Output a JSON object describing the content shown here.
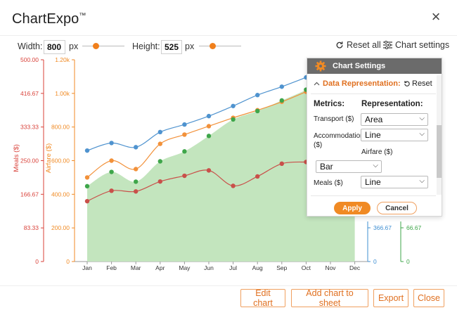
{
  "app": {
    "title": "ChartExpo",
    "trademark": "™",
    "close_label": "×"
  },
  "toolbar": {
    "width_label": "Width:",
    "width_value": "800",
    "width_unit": "px",
    "height_label": "Height:",
    "height_value": "525",
    "height_unit": "px",
    "width_slider_fraction": 0.3,
    "height_slider_fraction": 0.3,
    "reset_all_label": "Reset all",
    "chart_settings_label": "Chart settings"
  },
  "chart_data": {
    "type": "line",
    "categories": [
      "Jan",
      "Feb",
      "Mar",
      "Apr",
      "May",
      "Jun",
      "Jul",
      "Aug",
      "Sep",
      "Oct",
      "Nov",
      "Dec"
    ],
    "axes": [
      {
        "name": "Meals ($)",
        "color": "#d9423a",
        "ticks": [
          "500.00",
          "416.67",
          "333.33",
          "250.00",
          "166.67",
          "83.33",
          "0"
        ],
        "range": [
          0,
          500
        ]
      },
      {
        "name": "Airfare ($)",
        "color": "#f08a24",
        "ticks": [
          "1.20k",
          "1.00k",
          "800.00",
          "600.00",
          "400.00",
          "200.00",
          "0"
        ],
        "range": [
          0,
          1200
        ]
      },
      {
        "name": "Transport ($)",
        "color": "#3f8fd2",
        "ticks": [
          "366.67",
          "0"
        ]
      },
      {
        "name": "Accommodation ($)",
        "color": "#3ea64a",
        "ticks": [
          "66.67",
          "0"
        ]
      }
    ],
    "series": [
      {
        "name": "Transport ($)",
        "type": "line",
        "color": "#4f93cf",
        "values": [
          660,
          705,
          680,
          770,
          815,
          865,
          925,
          990,
          1040,
          1095,
          null,
          null
        ]
      },
      {
        "name": "Airfare ($)",
        "type": "line",
        "color": "#f2913a",
        "values": [
          500,
          600,
          550,
          700,
          755,
          805,
          855,
          900,
          950,
          1010,
          null,
          null
        ]
      },
      {
        "name": "Accommodation ($)",
        "type": "area",
        "color": "#3ea64a",
        "fill": "#c3e5be",
        "values": [
          448,
          533,
          475,
          596,
          655,
          747,
          845,
          895,
          958,
          1022,
          1110,
          1150
        ]
      },
      {
        "name": "Meals ($)",
        "type": "line",
        "color": "#c9504a",
        "values": [
          359,
          421,
          417,
          476,
          510,
          542,
          450,
          506,
          582,
          592,
          null,
          null
        ]
      }
    ]
  },
  "settings_panel": {
    "title": "Chart Settings",
    "section_label": "Data Representation:",
    "reset_label": "Reset",
    "metrics_header": "Metrics:",
    "representation_header": "Representation:",
    "rows": [
      {
        "metric": "Transport ($)",
        "value": "Area"
      },
      {
        "metric": "Accommodation ($)",
        "value": "Line"
      },
      {
        "metric": "Airfare ($)",
        "value": "Bar"
      },
      {
        "metric": "Meals ($)",
        "value": "Line"
      }
    ],
    "apply_label": "Apply",
    "cancel_label": "Cancel"
  },
  "footer": {
    "edit_chart_label": "Edit chart",
    "add_chart_label": "Add chart to sheet",
    "export_label": "Export",
    "close_label": "Close"
  }
}
